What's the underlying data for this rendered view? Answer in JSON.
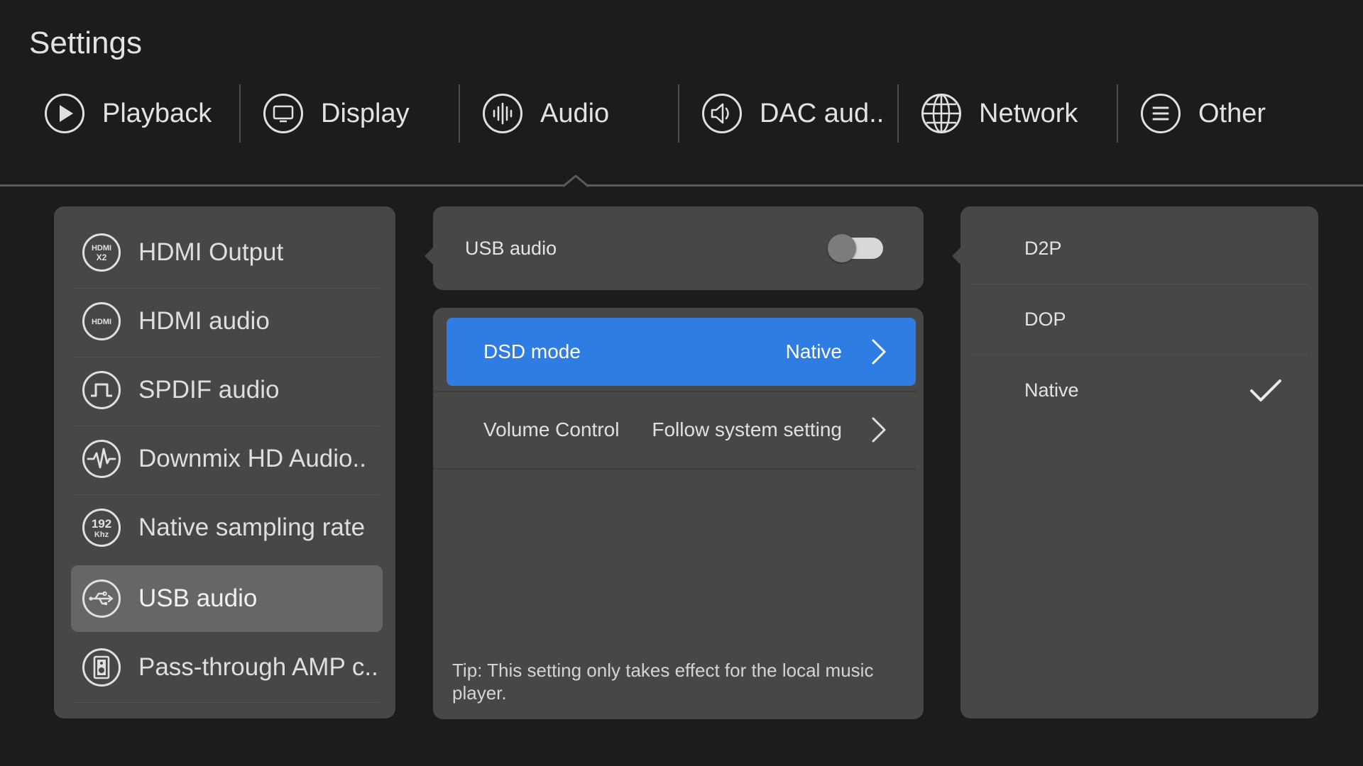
{
  "header": {
    "title": "Settings"
  },
  "tabs": [
    {
      "label": "Playback",
      "icon": "play-icon"
    },
    {
      "label": "Display",
      "icon": "monitor-icon"
    },
    {
      "label": "Audio",
      "icon": "audio-equalizer-icon"
    },
    {
      "label": "DAC aud..",
      "icon": "speaker-icon"
    },
    {
      "label": "Network",
      "icon": "globe-icon"
    },
    {
      "label": "Other",
      "icon": "menu-icon"
    }
  ],
  "active_tab": "Audio",
  "sidebar": {
    "items": [
      {
        "label": "HDMI Output",
        "icon": "hdmi-x2-icon",
        "icon_text": [
          "HDMI",
          "X2"
        ]
      },
      {
        "label": "HDMI audio",
        "icon": "hdmi-icon",
        "icon_text": [
          "HDMI"
        ]
      },
      {
        "label": "SPDIF audio",
        "icon": "square-wave-icon"
      },
      {
        "label": "Downmix HD Audio..",
        "icon": "waveform-icon"
      },
      {
        "label": "Native sampling rate",
        "icon": "sampling-rate-icon",
        "icon_text": [
          "192",
          "Khz"
        ]
      },
      {
        "label": "USB audio",
        "icon": "usb-icon"
      },
      {
        "label": "Pass-through AMP c..",
        "icon": "amplifier-icon"
      }
    ],
    "selected": "USB audio"
  },
  "usb_audio": {
    "label": "USB audio",
    "toggle_on": false
  },
  "options": {
    "rows": [
      {
        "label": "DSD mode",
        "value": "Native",
        "active": true
      },
      {
        "label": "Volume Control",
        "value": "Follow system setting",
        "active": false
      }
    ],
    "tip": "Tip: This setting only takes effect for the local music player."
  },
  "dsd_choices": {
    "items": [
      {
        "label": "D2P",
        "checked": false
      },
      {
        "label": "DOP",
        "checked": false
      },
      {
        "label": "Native",
        "checked": true
      }
    ]
  },
  "colors": {
    "background": "#1c1c1c",
    "panel": "#474747",
    "selected_item": "#666666",
    "accent": "#2f7de2"
  }
}
